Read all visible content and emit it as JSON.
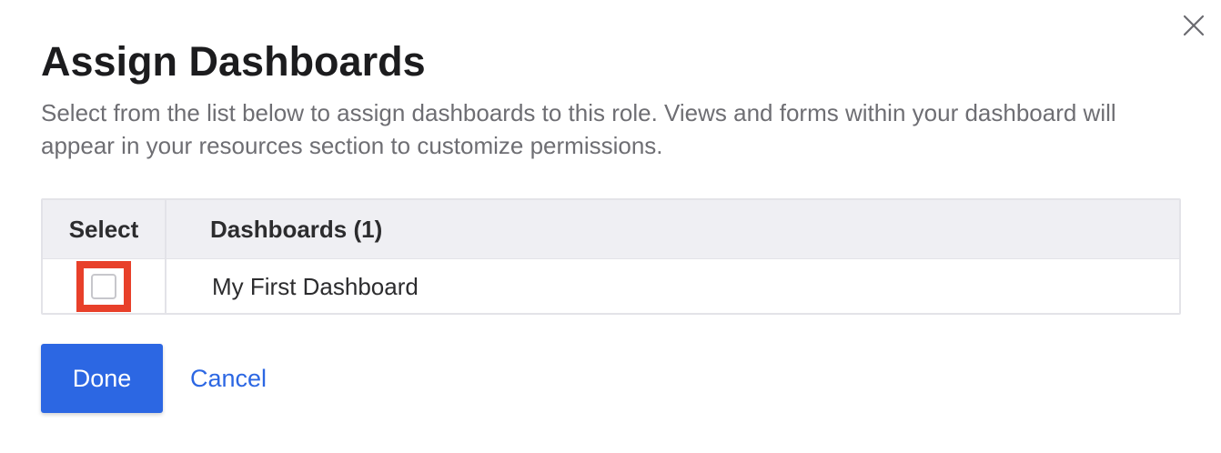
{
  "dialog": {
    "title": "Assign Dashboards",
    "description": "Select from the list below to assign dashboards to this role. Views and forms within your dashboard will appear in your resources section to customize permissions."
  },
  "table": {
    "headers": {
      "select": "Select",
      "dashboards": "Dashboards (1)"
    },
    "rows": [
      {
        "name": "My First Dashboard",
        "selected": false
      }
    ]
  },
  "actions": {
    "done_label": "Done",
    "cancel_label": "Cancel"
  },
  "colors": {
    "primary": "#2c67e3",
    "highlight": "#e8402a",
    "header_bg": "#efeff3"
  },
  "icons": {
    "close": "close-icon"
  }
}
